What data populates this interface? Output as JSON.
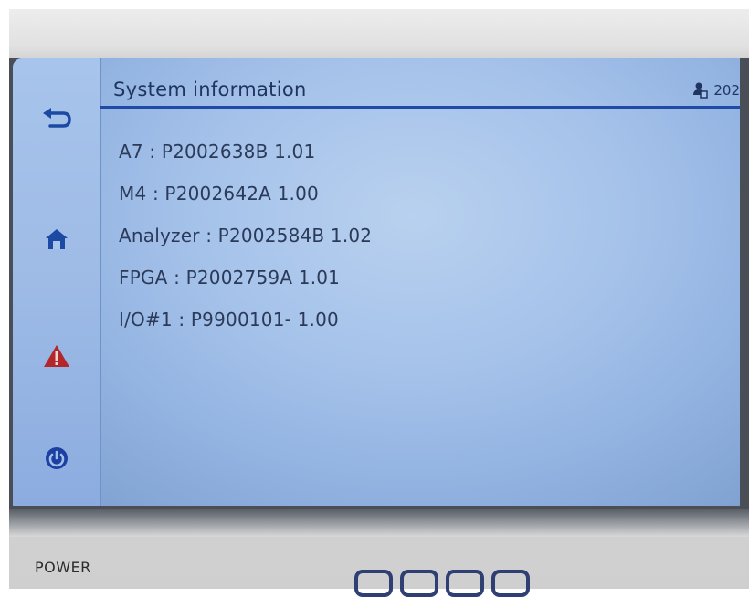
{
  "screen": {
    "title": "System information",
    "user_date": "202",
    "nav": {
      "back_icon": "back-arrow-icon",
      "home_icon": "home-icon",
      "alarm_icon": "warning-icon",
      "power_icon": "power-icon"
    },
    "info_lines": [
      "A7 : P2002638B 1.01",
      "M4 : P2002642A 1.00",
      "Analyzer : P2002584B 1.02",
      "FPGA : P2002759A 1.01",
      "I/O#1 : P9900101- 1.00"
    ]
  },
  "device": {
    "power_label": "POWER"
  },
  "colors": {
    "screen_bg": "#a5c2ea",
    "title_line": "#1f4aa6",
    "text": "#2a3a58",
    "nav_icon": "#1c4aa3",
    "alarm_icon": "#b3262a",
    "power_icon": "#1d3fa1",
    "housing": "#d9d9d9",
    "hardware_key": "#2f3f74"
  }
}
